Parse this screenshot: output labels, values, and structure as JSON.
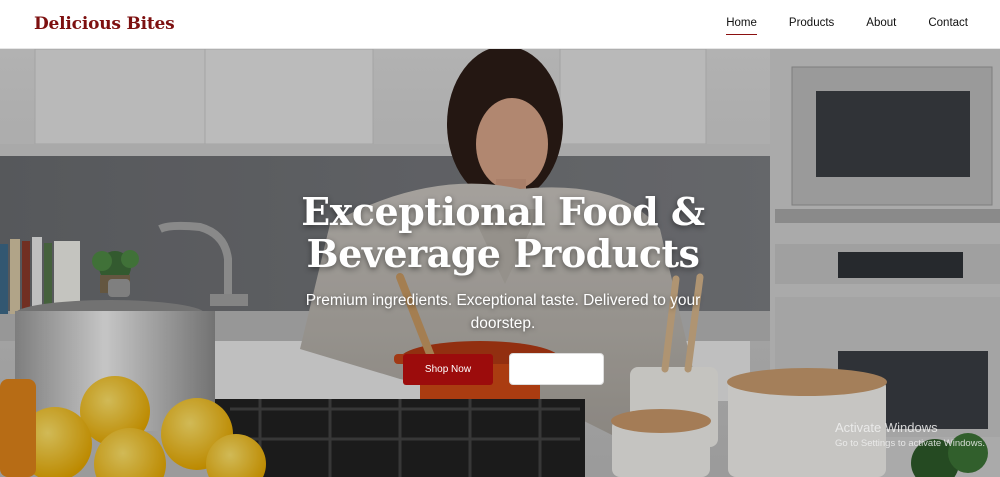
{
  "header": {
    "brand": "Delicious Bites",
    "nav": [
      {
        "label": "Home",
        "active": true
      },
      {
        "label": "Products",
        "active": false
      },
      {
        "label": "About",
        "active": false
      },
      {
        "label": "Contact",
        "active": false
      }
    ]
  },
  "hero": {
    "title_line1": "Exceptional Food &",
    "title_line2": "Beverage Products",
    "subtitle": "Premium ingredients. Exceptional taste. Delivered to your doorstep.",
    "primary_button": "Shop Now",
    "secondary_button": "",
    "background_description_icon": "kitchen-photo"
  },
  "watermark": {
    "title": "Activate Windows",
    "subtitle": "Go to Settings to activate Windows."
  },
  "colors": {
    "brand": "#7d1010",
    "accent": "#9c0c0c",
    "nav_active_underline": "#8b1010"
  }
}
